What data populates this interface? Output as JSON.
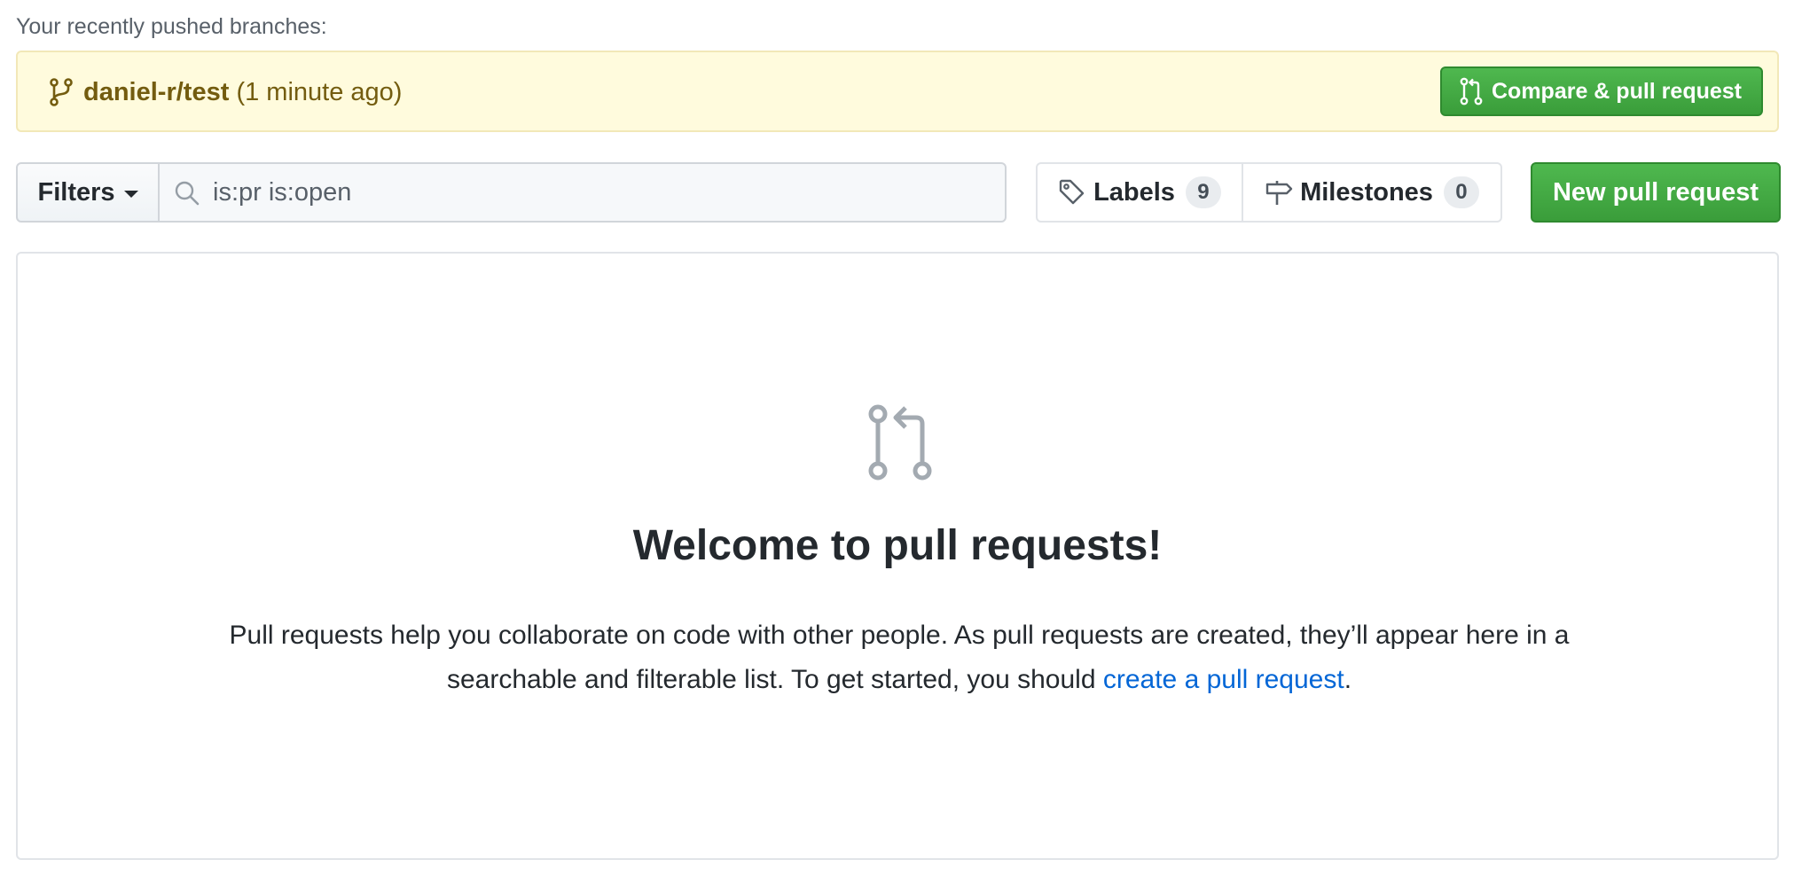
{
  "recent": {
    "heading": "Your recently pushed branches:",
    "branch_name": "daniel-r/test",
    "time_ago": "(1 minute ago)",
    "compare_label": "Compare & pull request"
  },
  "filters": {
    "label": "Filters"
  },
  "search": {
    "value": "is:pr is:open"
  },
  "labels": {
    "label": "Labels",
    "count": "9"
  },
  "milestones": {
    "label": "Milestones",
    "count": "0"
  },
  "new_pr": {
    "label": "New pull request"
  },
  "blankslate": {
    "title": "Welcome to pull requests!",
    "desc_part1": "Pull requests help you collaborate on code with other people. As pull requests are created, they’ll appear here in a searchable and filterable list. To get started, you should ",
    "link_text": "create a pull request",
    "desc_part2": "."
  },
  "colors": {
    "green_button": "#3a9d3a",
    "banner_bg": "#fffbdd",
    "banner_text": "#735c0f",
    "link": "#0366d6"
  },
  "icons": {
    "branch": "git-branch-icon",
    "compare": "git-pull-request-icon",
    "search": "search-icon",
    "labels": "tag-icon",
    "milestones": "milestone-icon",
    "blankslate": "git-pull-request-icon"
  }
}
